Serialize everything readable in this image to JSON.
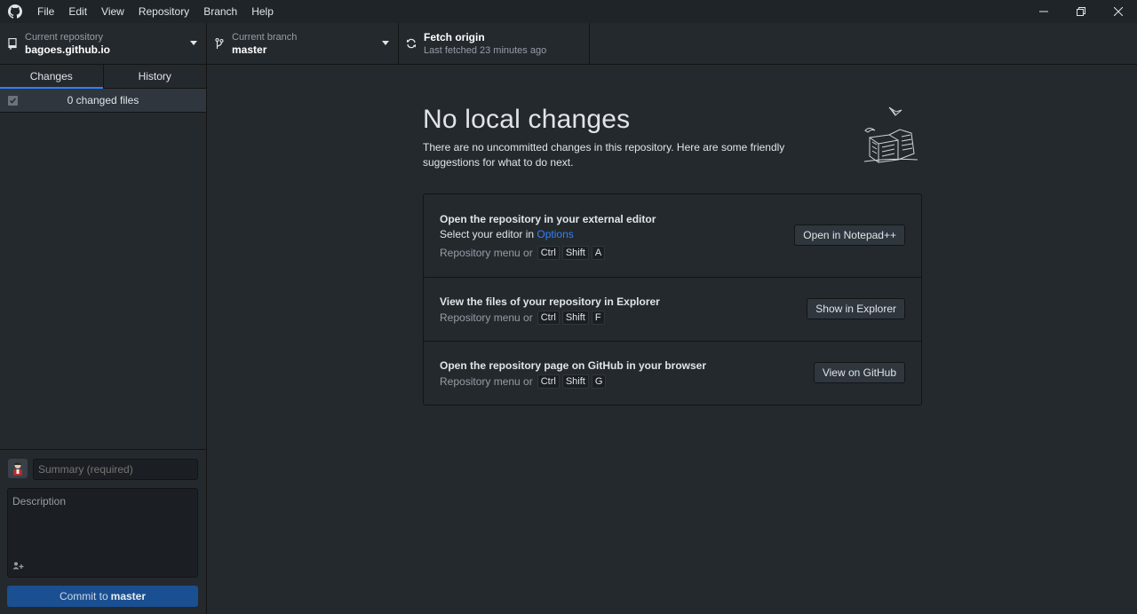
{
  "menu": [
    "File",
    "Edit",
    "View",
    "Repository",
    "Branch",
    "Help"
  ],
  "toolbar": {
    "repo_label": "Current repository",
    "repo_value": "bagoes.github.io",
    "branch_label": "Current branch",
    "branch_value": "master",
    "fetch_label": "Fetch origin",
    "fetch_sub": "Last fetched 23 minutes ago"
  },
  "sidebar": {
    "tabs": [
      "Changes",
      "History"
    ],
    "changed_files": "0 changed files",
    "summary_placeholder": "Summary (required)",
    "description_placeholder": "Description",
    "commit_prefix": "Commit to",
    "commit_branch": "master"
  },
  "main": {
    "title": "No local changes",
    "intro": "There are no uncommitted changes in this repository. Here are some friendly suggestions for what to do next.",
    "suggestions": [
      {
        "title": "Open the repository in your external editor",
        "line_prefix": "Select your editor in",
        "line_link": "Options",
        "keys_prefix": "Repository menu or",
        "keys": [
          "Ctrl",
          "Shift",
          "A"
        ],
        "button": "Open in Notepad++"
      },
      {
        "title": "View the files of your repository in Explorer",
        "keys_prefix": "Repository menu or",
        "keys": [
          "Ctrl",
          "Shift",
          "F"
        ],
        "button": "Show in Explorer"
      },
      {
        "title": "Open the repository page on GitHub in your browser",
        "keys_prefix": "Repository menu or",
        "keys": [
          "Ctrl",
          "Shift",
          "G"
        ],
        "button": "View on GitHub"
      }
    ]
  },
  "colors": {
    "background": "#24292e",
    "titlebar": "#1f2428",
    "accent": "#2f81f7",
    "commit_button": "#1a4f91"
  }
}
